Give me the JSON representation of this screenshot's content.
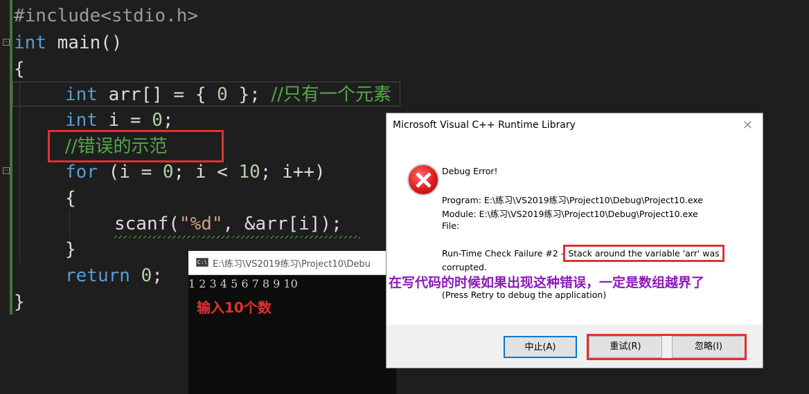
{
  "editor": {
    "lines": {
      "l1": {
        "pp": "#include<stdio.h>"
      },
      "l2": {
        "kw": "int",
        "rest": " main()"
      },
      "l3": {
        "text": "{"
      },
      "l4": {
        "kw": "int",
        "rest": " arr[] = { ",
        "num": "0",
        "rest2": " }; ",
        "comment": "//只有一个元素"
      },
      "l5": {
        "kw": "int",
        "rest": " i = ",
        "num": "0",
        "rest2": ";"
      },
      "l6": {
        "comment": "//错误的示范"
      },
      "l7": {
        "kw": "for",
        "rest": " (i = ",
        "num": "0",
        "rest2": "; i < ",
        "num2": "10",
        "rest3": "; i++)"
      },
      "l8": {
        "text": "{"
      },
      "l9": {
        "fn": "scanf(",
        "str": "\"%d\"",
        "rest": ", &arr[i]);"
      },
      "l10": {
        "text": "}"
      },
      "l11": {
        "kw": "return",
        "rest": " ",
        "num": "0",
        "rest2": ";"
      },
      "l12": {
        "text": "}"
      }
    }
  },
  "console": {
    "title": "E:\\练习\\VS2019练习\\Project10\\Debu",
    "output": "1 2 3 4 5 6 7 8 9 10",
    "note": "输入10个数"
  },
  "dialog": {
    "title": "Microsoft Visual C++ Runtime Library",
    "heading": "Debug Error!",
    "program": "Program: E:\\练习\\VS2019练习\\Project10\\Debug\\Project10.exe",
    "module": "Module: E:\\练习\\VS2019练习\\Project10\\Debug\\Project10.exe",
    "file": "File:",
    "failure_prefix": "Run-Time Check Failure #2 - ",
    "failure_highlight": "Stack around the variable 'arr' was",
    "failure_rest": "corrupted.",
    "retry_hint": "(Press Retry to debug the application)",
    "buttons": {
      "abort": "中止(A)",
      "retry": "重试(R)",
      "ignore": "忽略(I)"
    }
  },
  "annotation": "在写代码的时候如果出现这种错误，一定是数组越界了",
  "colors": {
    "highlight_box": "#e0322f",
    "annotation": "#8b1ab8",
    "comment": "#57a64a",
    "keyword": "#569cd6"
  }
}
